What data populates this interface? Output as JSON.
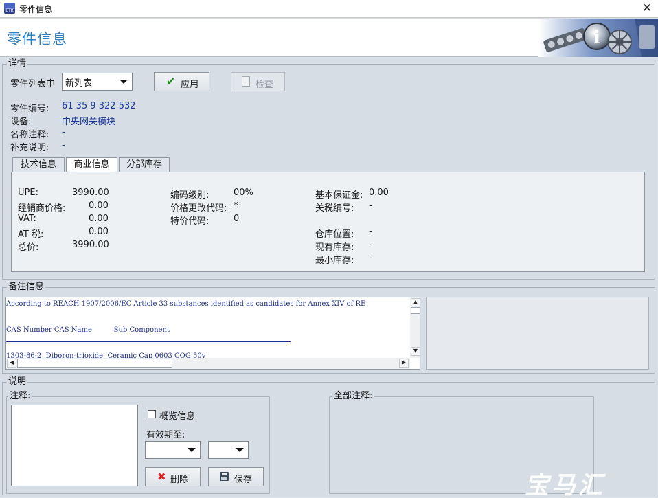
{
  "window": {
    "title": "零件信息",
    "app_icon": "ETK",
    "close": "✕"
  },
  "banner": {
    "title": "零件信息",
    "art": "info-parts-art"
  },
  "details": {
    "group_title": "详情",
    "list_label": "零件列表中",
    "list_selected": "新列表",
    "apply_button": "应用",
    "check_button": "检查",
    "fields": [
      {
        "label": "零件编号:",
        "value": "61 35 9 322 532"
      },
      {
        "label": "设备:",
        "value": "中央网关模块"
      },
      {
        "label": "名称注释:",
        "value": "-"
      },
      {
        "label": "补充说明:",
        "value": "-"
      }
    ],
    "tabs": [
      "技术信息",
      "商业信息",
      "分部库存"
    ],
    "active_tab": "商业信息",
    "commercial": {
      "col1": [
        {
          "label": "UPE:",
          "value": "3990.00"
        },
        {
          "label": "经销商价格:",
          "value": "0.00"
        },
        {
          "label": "VAT:",
          "value": "0.00"
        },
        {
          "label": "AT 税:",
          "value": "0.00"
        },
        {
          "label": "总价:",
          "value": "3990.00"
        }
      ],
      "col2": [
        {
          "label": "编码级别:",
          "value": "00%"
        },
        {
          "label": "价格更改代码:",
          "value": "*"
        },
        {
          "label": "特价代码:",
          "value": "0"
        }
      ],
      "col3_top": [
        {
          "label": "基本保证金:",
          "value": "0.00"
        },
        {
          "label": "关税编号:",
          "value": "-"
        }
      ],
      "col3_bottom": [
        {
          "label": "仓库位置:",
          "value": "-"
        },
        {
          "label": "现有库存:",
          "value": "-"
        },
        {
          "label": "最小库存:",
          "value": "-"
        }
      ]
    }
  },
  "remarks": {
    "group_title": "备注信息",
    "lines": [
      "According to REACH 1907/2006/EC Article 33 substances identified as candidates for Annex XIV of RE",
      "CAS Number CAS Name          Sub Component",
      "1303-86-2  Diboron-trioxide  Ceramic Cap 0603 COG 50v"
    ]
  },
  "explanation": {
    "group_title": "说明",
    "comment_title": "注释:",
    "overview_checkbox": "概览信息",
    "valid_until": "有效期至:",
    "delete_button": "删除",
    "save_button": "保存",
    "all_comments_title": "全部注释:"
  },
  "watermark": "宝马汇"
}
